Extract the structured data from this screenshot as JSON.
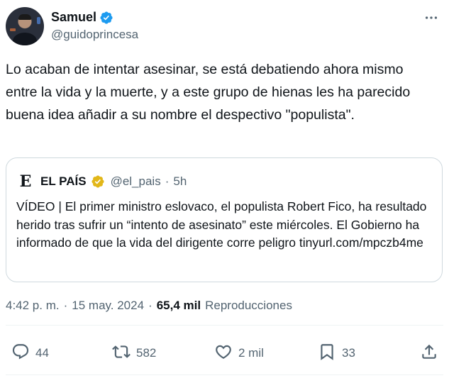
{
  "author": {
    "display_name": "Samuel",
    "handle": "@guidoprincesa"
  },
  "tweet": {
    "text": "Lo acaban de intentar asesinar, se está debatiendo ahora mismo entre la vida y la muerte, y a este grupo de hienas les ha parecido buena idea añadir a su nombre el despectivo \"populista\"."
  },
  "quote": {
    "logo_letter": "E",
    "name": "EL PAÍS",
    "handle": "@el_pais",
    "separator": "·",
    "time": "5h",
    "text": "VÍDEO | El primer ministro eslovaco, el populista Robert Fico, ha resultado herido tras sufrir un “intento de asesinato” este miércoles. El Gobierno ha informado de que la vida del dirigente corre peligro tinyurl.com/mpczb4me"
  },
  "meta": {
    "time": "4:42 p. m.",
    "sep1": "·",
    "date": "15 may. 2024",
    "sep2": "·",
    "views_count": "65,4 mil",
    "views_label": "Reproducciones"
  },
  "actions": {
    "replies": "44",
    "retweets": "582",
    "likes": "2 mil",
    "bookmarks": "33"
  },
  "colors": {
    "verified_blue": "#1d9bf0",
    "gold_badge": "#e2b719",
    "secondary_text": "#536471",
    "primary_text": "#0f1419"
  },
  "icons": [
    "verified-icon",
    "more-icon",
    "gold-verified-icon",
    "reply-icon",
    "retweet-icon",
    "like-icon",
    "bookmark-icon",
    "share-icon"
  ]
}
